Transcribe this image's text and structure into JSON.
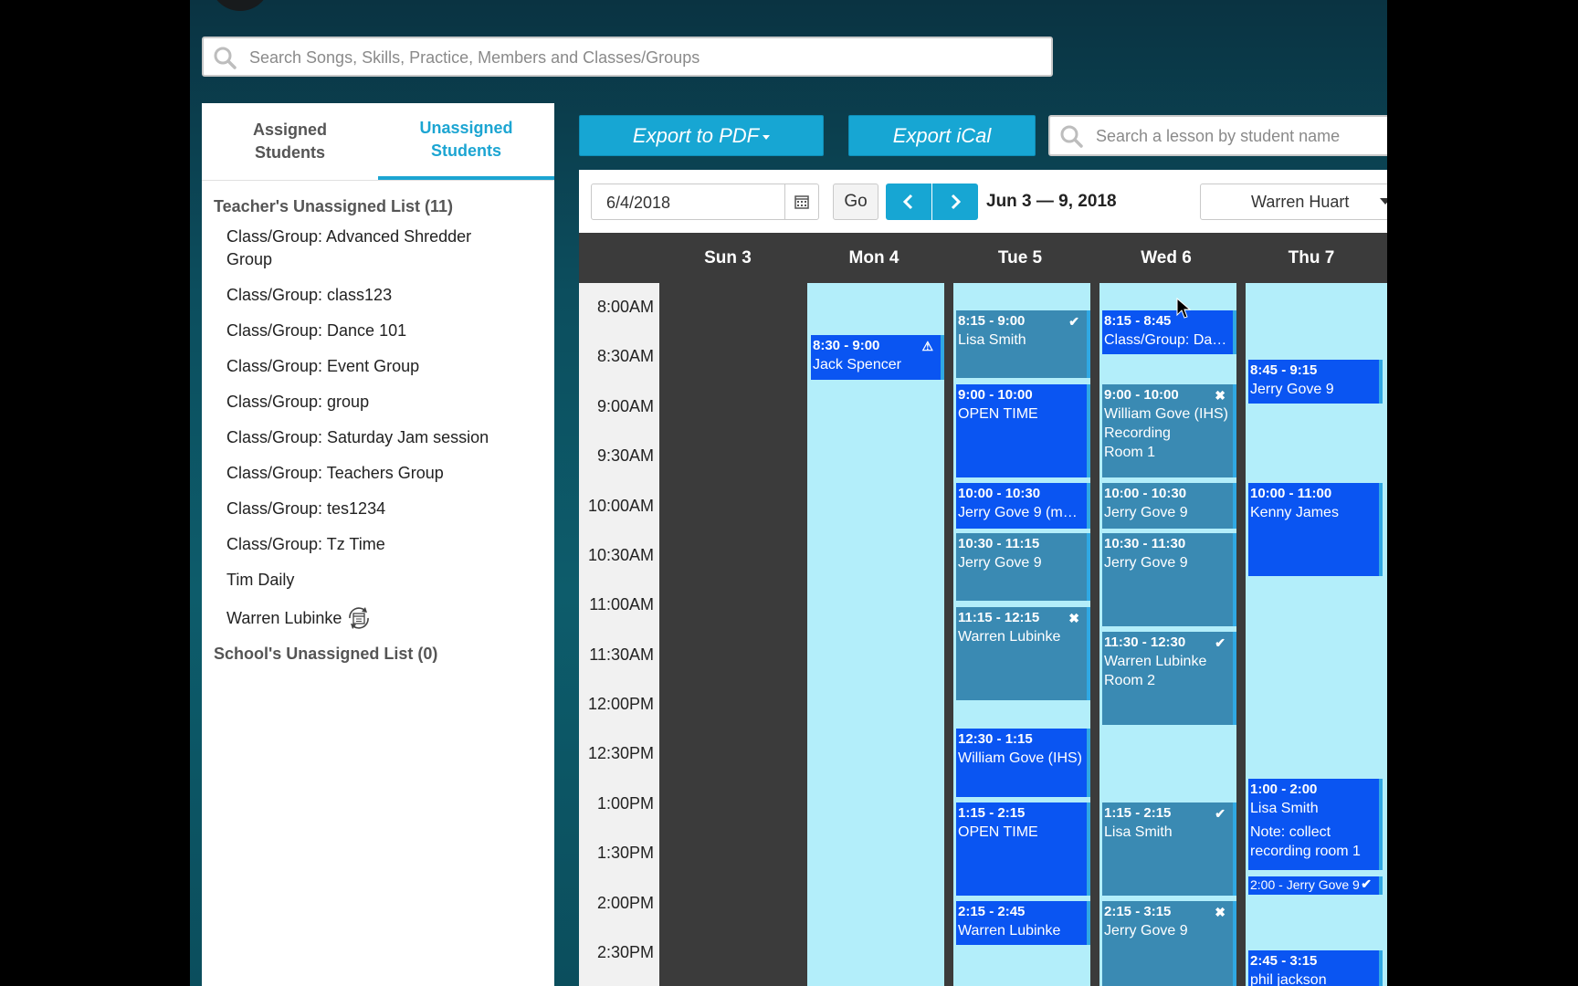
{
  "global_search": {
    "placeholder": "Search Songs, Skills, Practice, Members and Classes/Groups",
    "icon": "search-icon"
  },
  "left_panel": {
    "tabs": [
      {
        "label": "Assigned\nStudents",
        "active": false
      },
      {
        "label": "Unassigned\nStudents",
        "active": true
      }
    ],
    "teacher_list_title": "Teacher's Unassigned List (11)",
    "teacher_items": [
      "Class/Group: Advanced Shredder Group",
      "Class/Group: class123",
      "Class/Group: Dance 101",
      "Class/Group: Event Group",
      "Class/Group: group",
      "Class/Group: Saturday Jam session",
      "Class/Group: Teachers Group",
      "Class/Group: tes1234",
      "Class/Group: Tz Time",
      "Tim Daily",
      "Warren Lubinke"
    ],
    "school_list_title": "School's Unassigned List (0)"
  },
  "actions": {
    "export_pdf": "Export to PDF",
    "export_ical": "Export iCal",
    "lesson_search_placeholder": "Search a lesson by student name"
  },
  "calendar": {
    "date_value": "6/4/2018",
    "go_label": "Go",
    "range_label": "Jun 3 — 9, 2018",
    "teacher": "Warren Huart",
    "days": [
      "Sun 3",
      "Mon 4",
      "Tue 5",
      "Wed 6",
      "Thu 7"
    ],
    "times": [
      "8:00AM",
      "8:30AM",
      "9:00AM",
      "9:30AM",
      "10:00AM",
      "10:30AM",
      "11:00AM",
      "11:30AM",
      "12:00PM",
      "12:30PM",
      "1:00PM",
      "1:30PM",
      "2:00PM",
      "2:30PM"
    ],
    "events": {
      "mon": [
        {
          "time": "8:30 - 9:00",
          "title": "Jack Spencer",
          "mark": "⚠"
        }
      ],
      "tue": [
        {
          "time": "8:15 - 9:00",
          "title": "Lisa Smith",
          "mark": "✔"
        },
        {
          "time": "9:00 - 10:00",
          "title": "OPEN TIME"
        },
        {
          "time": "10:00 - 10:30",
          "title": "Jerry Gove 9 (ma…"
        },
        {
          "time": "10:30 - 11:15",
          "title": "Jerry Gove 9"
        },
        {
          "time": "11:15 - 12:15",
          "title": "Warren Lubinke",
          "mark": "✖"
        },
        {
          "time": "12:30 - 1:15",
          "title": "William Gove (IHS)"
        },
        {
          "time": "1:15 - 2:15",
          "title": "OPEN TIME"
        },
        {
          "time": "2:15 - 2:45",
          "title": "Warren Lubinke"
        }
      ],
      "wed": [
        {
          "time": "8:15 - 8:45",
          "title": "Class/Group: Da…"
        },
        {
          "time": "9:00 - 10:00",
          "title": "William Gove (IHS)",
          "extra": "Recording",
          "extra2": "Room 1",
          "mark": "✖"
        },
        {
          "time": "10:00 - 10:30",
          "title": "Jerry Gove 9"
        },
        {
          "time": "10:30 - 11:30",
          "title": "Jerry Gove 9"
        },
        {
          "time": "11:30 - 12:30",
          "title": "Warren Lubinke",
          "extra": "Room 2",
          "mark": "✔"
        },
        {
          "time": "1:15 - 2:15",
          "title": "Lisa Smith",
          "mark": "✔"
        },
        {
          "time": "2:15 - 3:15",
          "title": "Jerry Gove 9",
          "mark": "✖"
        }
      ],
      "thu": [
        {
          "time": "8:45 - 9:15",
          "title": "Jerry Gove 9"
        },
        {
          "time": "10:00 - 11:00",
          "title": "Kenny James"
        },
        {
          "time": "1:00 - 2:00",
          "title": "Lisa Smith",
          "extra": "Note: collect recording room 1"
        },
        {
          "time": "2:00 -",
          "title": "Jerry Gove 9",
          "mark": "✔"
        },
        {
          "time": "2:45 - 3:15",
          "title": "phil jackson"
        }
      ]
    }
  },
  "colors": {
    "accent": "#17a6d3",
    "event_bright": "#0a55f2",
    "event_teal": "#3a8ab3",
    "day_bg": "#b3eefa"
  }
}
